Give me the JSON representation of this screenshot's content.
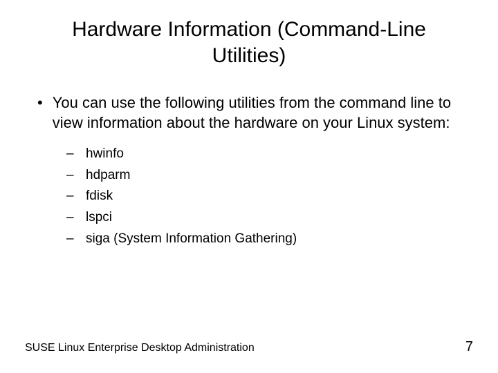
{
  "title": "Hardware Information (Command-Line Utilities)",
  "bullet_marker": "•",
  "intro_text": "You can use the following utilities from the command line to view information about the hardware on your Linux system:",
  "sub_marker": "–",
  "utilities": [
    "hwinfo",
    "hdparm",
    "fdisk",
    "lspci",
    "siga (System Information Gathering)"
  ],
  "footer": {
    "left": "SUSE Linux Enterprise Desktop Administration",
    "right": "7"
  }
}
